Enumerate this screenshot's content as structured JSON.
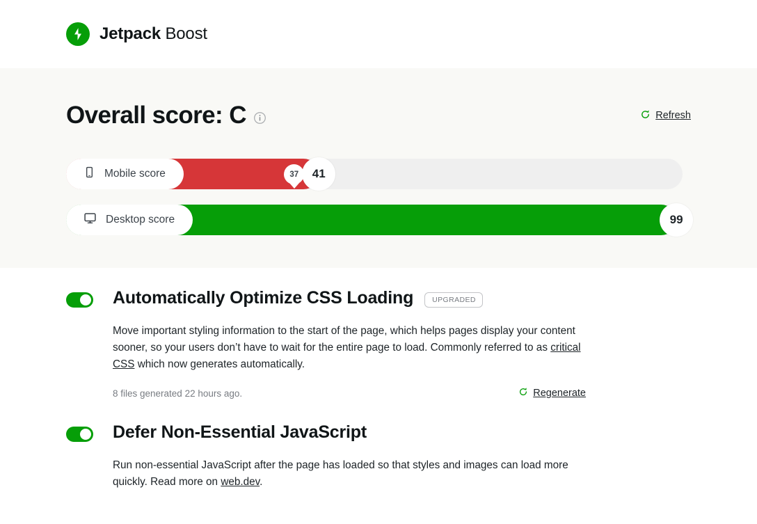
{
  "header": {
    "logo_icon": "jetpack-bolt-icon",
    "brand_bold": "Jetpack",
    "brand_light": "Boost",
    "brand_color": "#069e08"
  },
  "score_panel": {
    "title": "Overall score: C",
    "info_icon": "info-icon",
    "refresh": {
      "icon": "refresh-icon",
      "label": "Refresh"
    },
    "bars": [
      {
        "icon": "mobile-phone-icon",
        "label": "Mobile score",
        "value": "41",
        "previous": "37",
        "color": "#d63638",
        "fill_percent": 41,
        "previous_percent": 37
      },
      {
        "icon": "desktop-monitor-icon",
        "label": "Desktop score",
        "value": "99",
        "previous": null,
        "color": "#069e08",
        "fill_percent": 99,
        "previous_percent": null
      }
    ]
  },
  "features": [
    {
      "toggle_on": true,
      "title": "Automatically Optimize CSS Loading",
      "badge": "UPGRADED",
      "desc_part1": "Move important styling information to the start of the page, which helps pages display your content sooner, so your users don’t have to wait for the entire page to load. Commonly referred to as ",
      "desc_link": "critical CSS",
      "desc_part2": " which now generates automatically.",
      "foot_note": "8 files generated 22 hours ago.",
      "foot_action": {
        "icon": "refresh-icon",
        "label": "Regenerate"
      }
    },
    {
      "toggle_on": true,
      "title": "Defer Non-Essential JavaScript",
      "badge": null,
      "desc_part1": "Run non-essential JavaScript after the page has loaded so that styles and images can load more quickly. Read more on ",
      "desc_link": "web.dev",
      "desc_part2": ".",
      "foot_note": null,
      "foot_action": null
    }
  ]
}
